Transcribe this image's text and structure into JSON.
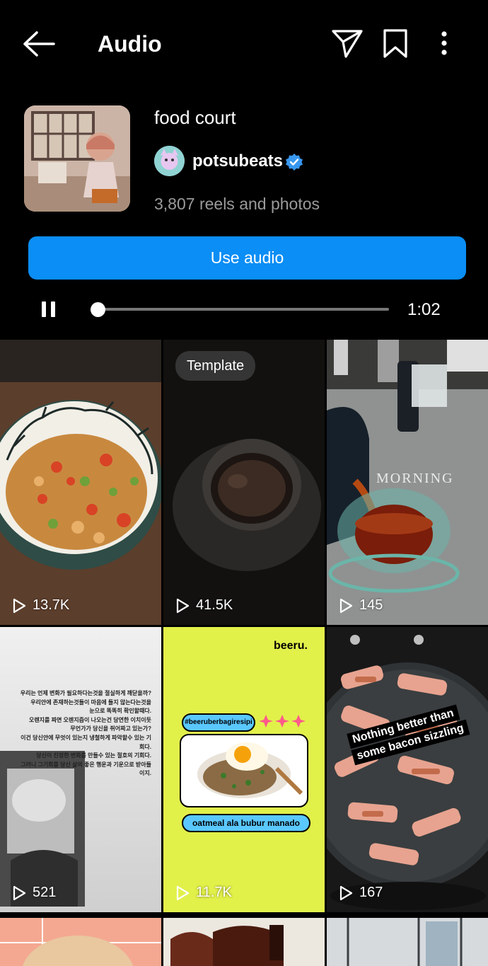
{
  "header": {
    "title": "Audio",
    "back_icon": "arrow-left-icon",
    "share_icon": "paper-plane-icon",
    "save_icon": "bookmark-icon",
    "more_icon": "vertical-dots-icon"
  },
  "audio": {
    "track_name": "food court",
    "artist": "potsubeats",
    "verified": true,
    "reels_count": "3,807 reels and photos",
    "use_button": "Use audio",
    "duration": "1:02",
    "progress": 0,
    "playing": true
  },
  "grid": [
    {
      "views": "13.7K",
      "badge": "",
      "description": "fried rice bowl"
    },
    {
      "views": "41.5K",
      "badge": "Template",
      "description": "coffee cup"
    },
    {
      "views": "145",
      "badge": "",
      "overlay": "MORNING",
      "description": "pouring tea"
    },
    {
      "views": "521",
      "badge": "",
      "korean_text": [
        "우리는 언제 변화가 필요하다는것을 절실하게 깨닫을까?",
        "우리안에 존재하는것들이 마음에 들지 않는다는것을",
        "눈으로 똑똑히 확인할때다.",
        "오렌지를 짜면 오렌지즙이 나오는건 당연한 이치이듯",
        "무언가가 당신을 쥐어짜고 있는가?",
        "이건 당신안에 무엇이 있는지 냉철하게 파악할수 있는 기회다.",
        "당신이 진정한 변화를 만들수 있는 절호의 기회다.",
        "그러니 그기회를 당신 삶의 좋은 행운과 기운으로 받아들이지."
      ]
    },
    {
      "views": "11.7K",
      "badge": "",
      "brand": "beeru.",
      "hashtag": "#beeruberbagiresipi",
      "recipe": "oatmeal ala bubur manado"
    },
    {
      "views": "167",
      "badge": "",
      "caption": [
        "Nothing better than",
        "some bacon sizzling"
      ]
    }
  ],
  "colors": {
    "accent": "#0b8ef5",
    "verified": "#3897f0",
    "background": "#000000"
  }
}
